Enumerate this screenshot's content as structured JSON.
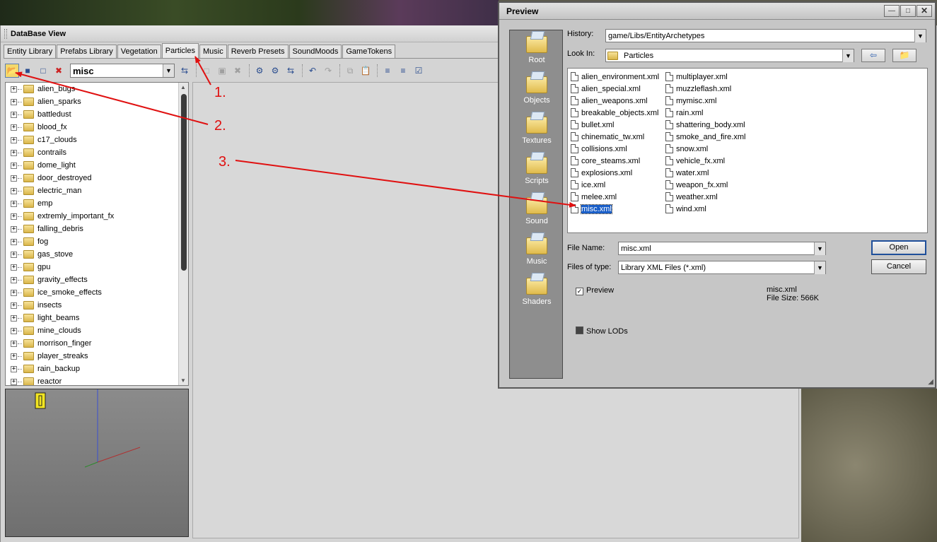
{
  "database_view": {
    "title": "DataBase View",
    "tabs": [
      "Entity Library",
      "Prefabs Library",
      "Vegetation",
      "Particles",
      "Music",
      "Reverb Presets",
      "SoundMoods",
      "GameTokens"
    ],
    "active_tab": "Particles",
    "library_combo": "misc",
    "tree_items": [
      "alien_bugs",
      "alien_sparks",
      "battledust",
      "blood_fx",
      "c17_clouds",
      "contrails",
      "dome_light",
      "door_destroyed",
      "electric_man",
      "emp",
      "extremly_important_fx",
      "falling_debris",
      "fog",
      "gas_stove",
      "gpu",
      "gravity_effects",
      "ice_smoke_effects",
      "insects",
      "light_beams",
      "mine_clouds",
      "morrison_finger",
      "player_streaks",
      "rain_backup",
      "reactor"
    ]
  },
  "dialog": {
    "title": "Preview",
    "places": [
      "Root",
      "Objects",
      "Textures",
      "Scripts",
      "Sound",
      "Music",
      "Shaders"
    ],
    "history_label": "History:",
    "history_value": "game/Libs/EntityArchetypes",
    "look_in_label": "Look In:",
    "look_in_value": "Particles",
    "files_col1": [
      "alien_environment.xml",
      "alien_special.xml",
      "alien_weapons.xml",
      "breakable_objects.xml",
      "bullet.xml",
      "chinematic_tw.xml",
      "collisions.xml",
      "core_steams.xml",
      "explosions.xml",
      "ice.xml",
      "melee.xml",
      "misc.xml"
    ],
    "files_col2": [
      "multiplayer.xml",
      "muzzleflash.xml",
      "mymisc.xml",
      "rain.xml",
      "shattering_body.xml",
      "smoke_and_fire.xml",
      "snow.xml",
      "vehicle_fx.xml",
      "water.xml",
      "weapon_fx.xml",
      "weather.xml",
      "wind.xml"
    ],
    "selected_file": "misc.xml",
    "file_name_label": "File Name:",
    "file_name_value": "misc.xml",
    "file_type_label": "Files of type:",
    "file_type_value": "Library XML Files (*.xml)",
    "open_label": "Open",
    "cancel_label": "Cancel",
    "preview_checkbox_label": "Preview",
    "preview_checked": true,
    "show_lods_label": "Show LODs",
    "info_name": "misc.xml",
    "info_size": "File Size: 566K"
  },
  "annotations": [
    "1.",
    "2.",
    "3."
  ],
  "colors": {
    "annotation": "#e01010",
    "selection": "#1a5fc9"
  },
  "icons": [
    "open-folder-icon",
    "save-icon",
    "new-icon",
    "delete-icon",
    "refresh-icon",
    "undo-icon",
    "redo-icon",
    "copy-icon",
    "paste-icon",
    "back-arrow-icon",
    "up-folder-icon"
  ]
}
